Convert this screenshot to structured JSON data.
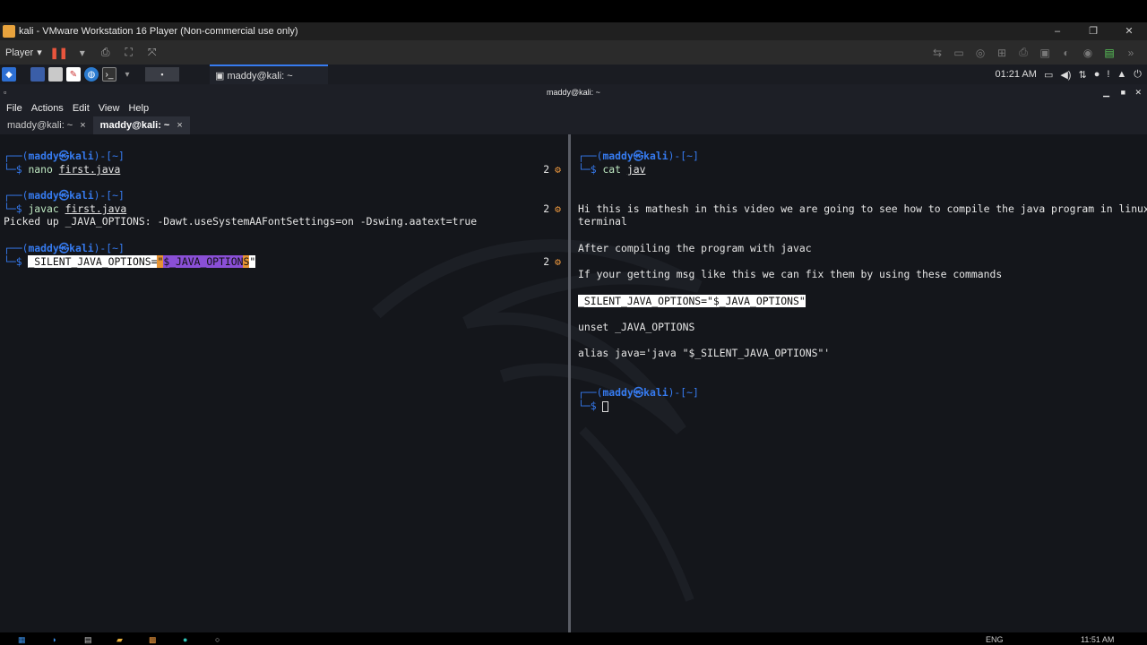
{
  "vmware": {
    "title": "kali  - VMware Workstation 16 Player (Non-commercial use only)",
    "player_label": "Player",
    "player_caret": "▾",
    "minimize": "–",
    "restore": "❐",
    "close": "✕"
  },
  "kali_panel": {
    "task_label": "maddy@kali: ~",
    "clock": "01:21 AM"
  },
  "terminal": {
    "window_title": "maddy@kali: ~",
    "menu": [
      "File",
      "Actions",
      "Edit",
      "View",
      "Help"
    ],
    "tabs": [
      {
        "label": "maddy@kali: ~",
        "close": "×"
      },
      {
        "label": "maddy@kali: ~",
        "close": "×"
      }
    ]
  },
  "left_pane": {
    "prompt_open": "┌──(",
    "prompt_user": "maddy㉿kali",
    "prompt_close": ")-[~]",
    "prompt_dollar": "└─$ ",
    "cmd1_name": "nano",
    "cmd1_arg": "first.java",
    "cmd2_name": "javac",
    "cmd2_arg": "first.java",
    "output_line": "Picked up _JAVA_OPTIONS: -Dawt.useSystemAAFontSettings=on -Dswing.aatext=true",
    "cmd3_part1": "_SILENT_JAVA_OPTIONS=",
    "cmd3_part2": "\"",
    "cmd3_part3": "$_JAVA_OPTION",
    "cmd3_part4": "S",
    "cmd3_part5": "\"",
    "line_badge": "2",
    "gear": "⚙"
  },
  "right_pane": {
    "prompt_open": "┌──(",
    "prompt_user": "maddy㉿kali",
    "prompt_close": ")-[~]",
    "prompt_dollar": "└─$ ",
    "cmd_name": "cat",
    "cmd_arg": "jav",
    "text1": "Hi this is mathesh in this video we are going to see how to compile the java program in linux",
    "text1b": "terminal",
    "text2": "After compiling the program with javac",
    "text3": "If your getting msg like this we can fix them by using these commands",
    "text4": "_SILENT_JAVA_OPTIONS=\"$_JAVA_OPTIONS\"",
    "text5": "unset _JAVA_OPTIONS",
    "text6": "alias java='java \"$_SILENT_JAVA_OPTIONS\"'"
  },
  "win_taskbar": {
    "lang": "ENG",
    "time": "11:51 AM"
  }
}
